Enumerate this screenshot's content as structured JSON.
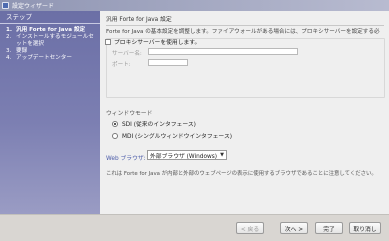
{
  "window": {
    "title": "設定ウィザード"
  },
  "steps_panel": {
    "header": "ステップ",
    "items": [
      {
        "num": "1.",
        "label": "汎用 Forte for Java 設定",
        "active": true
      },
      {
        "num": "2.",
        "label": "インストールするモジュールセットを選択",
        "active": false
      },
      {
        "num": "3.",
        "label": "要録",
        "active": false
      },
      {
        "num": "4.",
        "label": "アップデートセンター",
        "active": false
      }
    ]
  },
  "content": {
    "step_title": "汎用 Forte for Java 設定",
    "description": "Forte for Java の基本設定を調整します。ファイアウォールがある場合には、プロキシサーバーを設定する必",
    "proxy": {
      "checkbox_label": "プロキシサーバーを使用します。",
      "server_label": "サーバー名:",
      "server_value": "",
      "port_label": "ポート:",
      "port_value": ""
    },
    "window_mode": {
      "label": "ウィンドウモード",
      "options": [
        {
          "label": "SDI (従来のインタフェース)",
          "selected": true
        },
        {
          "label": "MDI (シングルウィンドウインタフェース)",
          "selected": false
        }
      ]
    },
    "browser": {
      "label": "Web ブラウザ:",
      "selected": "外部ブラウザ (Windows)"
    },
    "note": "これは Forte for Java が内部と外部のウェブページの表示に使用するブラウザであることに注意してください。"
  },
  "footer": {
    "back": "< 戻る",
    "next": "次へ >",
    "finish": "完了",
    "cancel": "取り消し"
  }
}
